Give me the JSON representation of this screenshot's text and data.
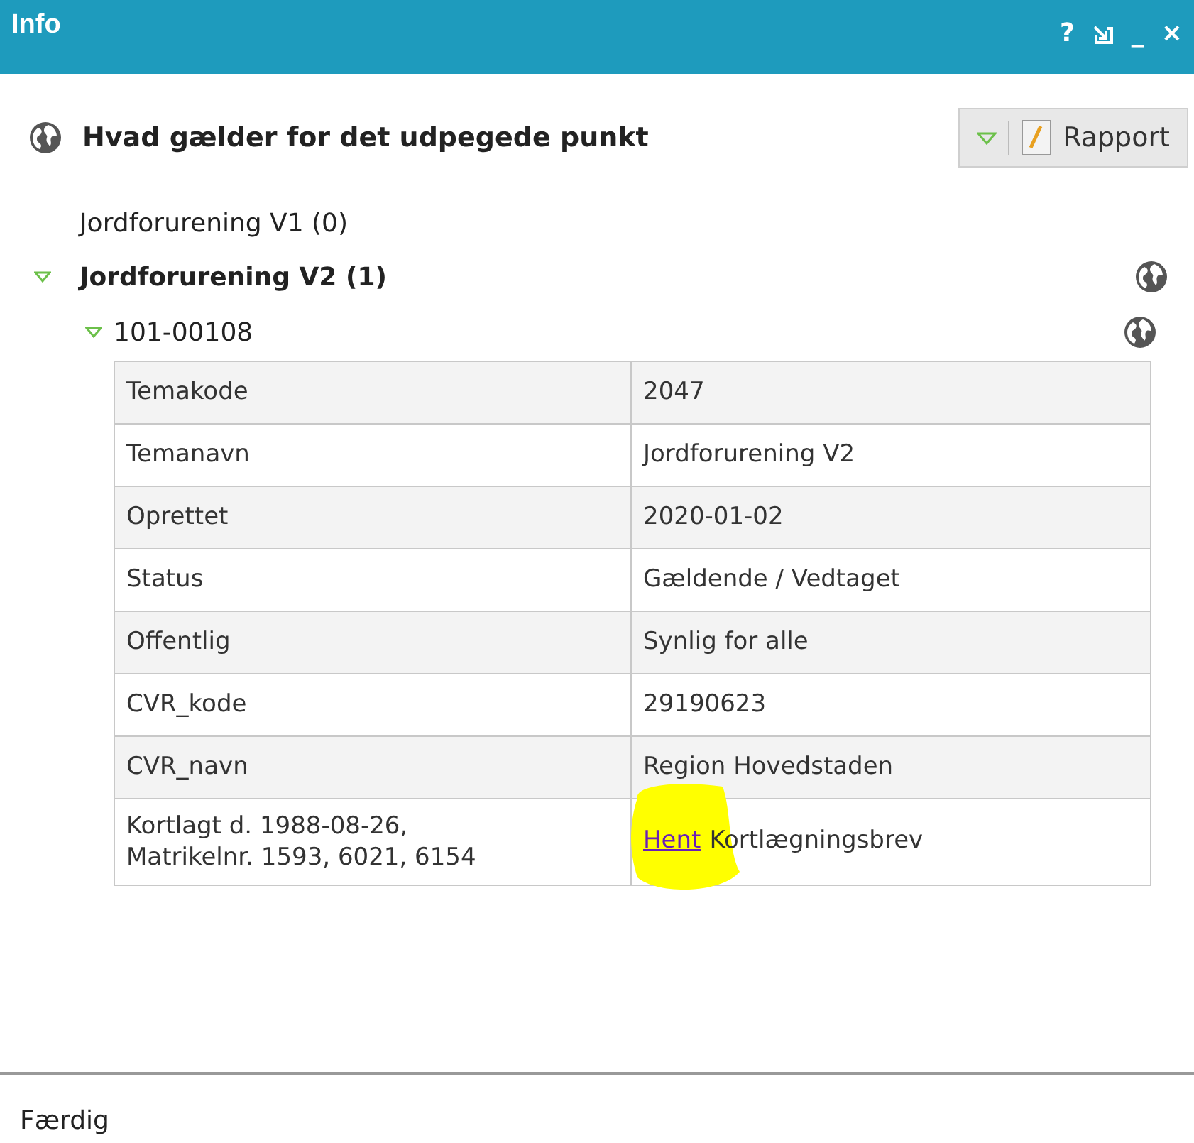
{
  "window": {
    "title": "Info",
    "buttons": [
      {
        "kind": "text",
        "label": "?"
      },
      {
        "kind": "dock"
      },
      {
        "kind": "text",
        "label": "_"
      },
      {
        "kind": "text",
        "label": "×"
      }
    ]
  },
  "header": {
    "title": "Hvad gælder for det udpegede punkt",
    "report_button": "Rapport"
  },
  "tree": [
    {
      "label": "Jordforurening V1 (0)",
      "expandable": false,
      "expanded": false,
      "globe": false
    },
    {
      "label": "Jordforurening V2 (1)",
      "expandable": true,
      "expanded": true,
      "globe": true,
      "children": [
        {
          "label": "101-00108",
          "expandable": true,
          "expanded": true,
          "globe": true
        }
      ]
    }
  ],
  "table": {
    "rows": [
      {
        "label": "Temakode",
        "kind": "text",
        "value": "2047"
      },
      {
        "label": "Temanavn",
        "kind": "text",
        "value": "Jordforurening V2"
      },
      {
        "label": "Oprettet",
        "kind": "text",
        "value": "2020-01-02"
      },
      {
        "label": "Status",
        "kind": "text",
        "value": "Gældende / Vedtaget"
      },
      {
        "label": "Offentlig",
        "kind": "text",
        "value": "Synlig for alle"
      },
      {
        "label": "CVR_kode",
        "kind": "text",
        "value": "29190623"
      },
      {
        "label": "CVR_navn",
        "kind": "text",
        "value": "Region Hovedstaden"
      },
      {
        "label": "Kortlagt d. 1988-08-26,\nMatrikelnr. 1593, 6021, 6154",
        "kind": "link",
        "link": "Hent",
        "value": "Kortlægningsbrev",
        "highlighted": true
      }
    ]
  },
  "status_bar": "Færdig"
}
